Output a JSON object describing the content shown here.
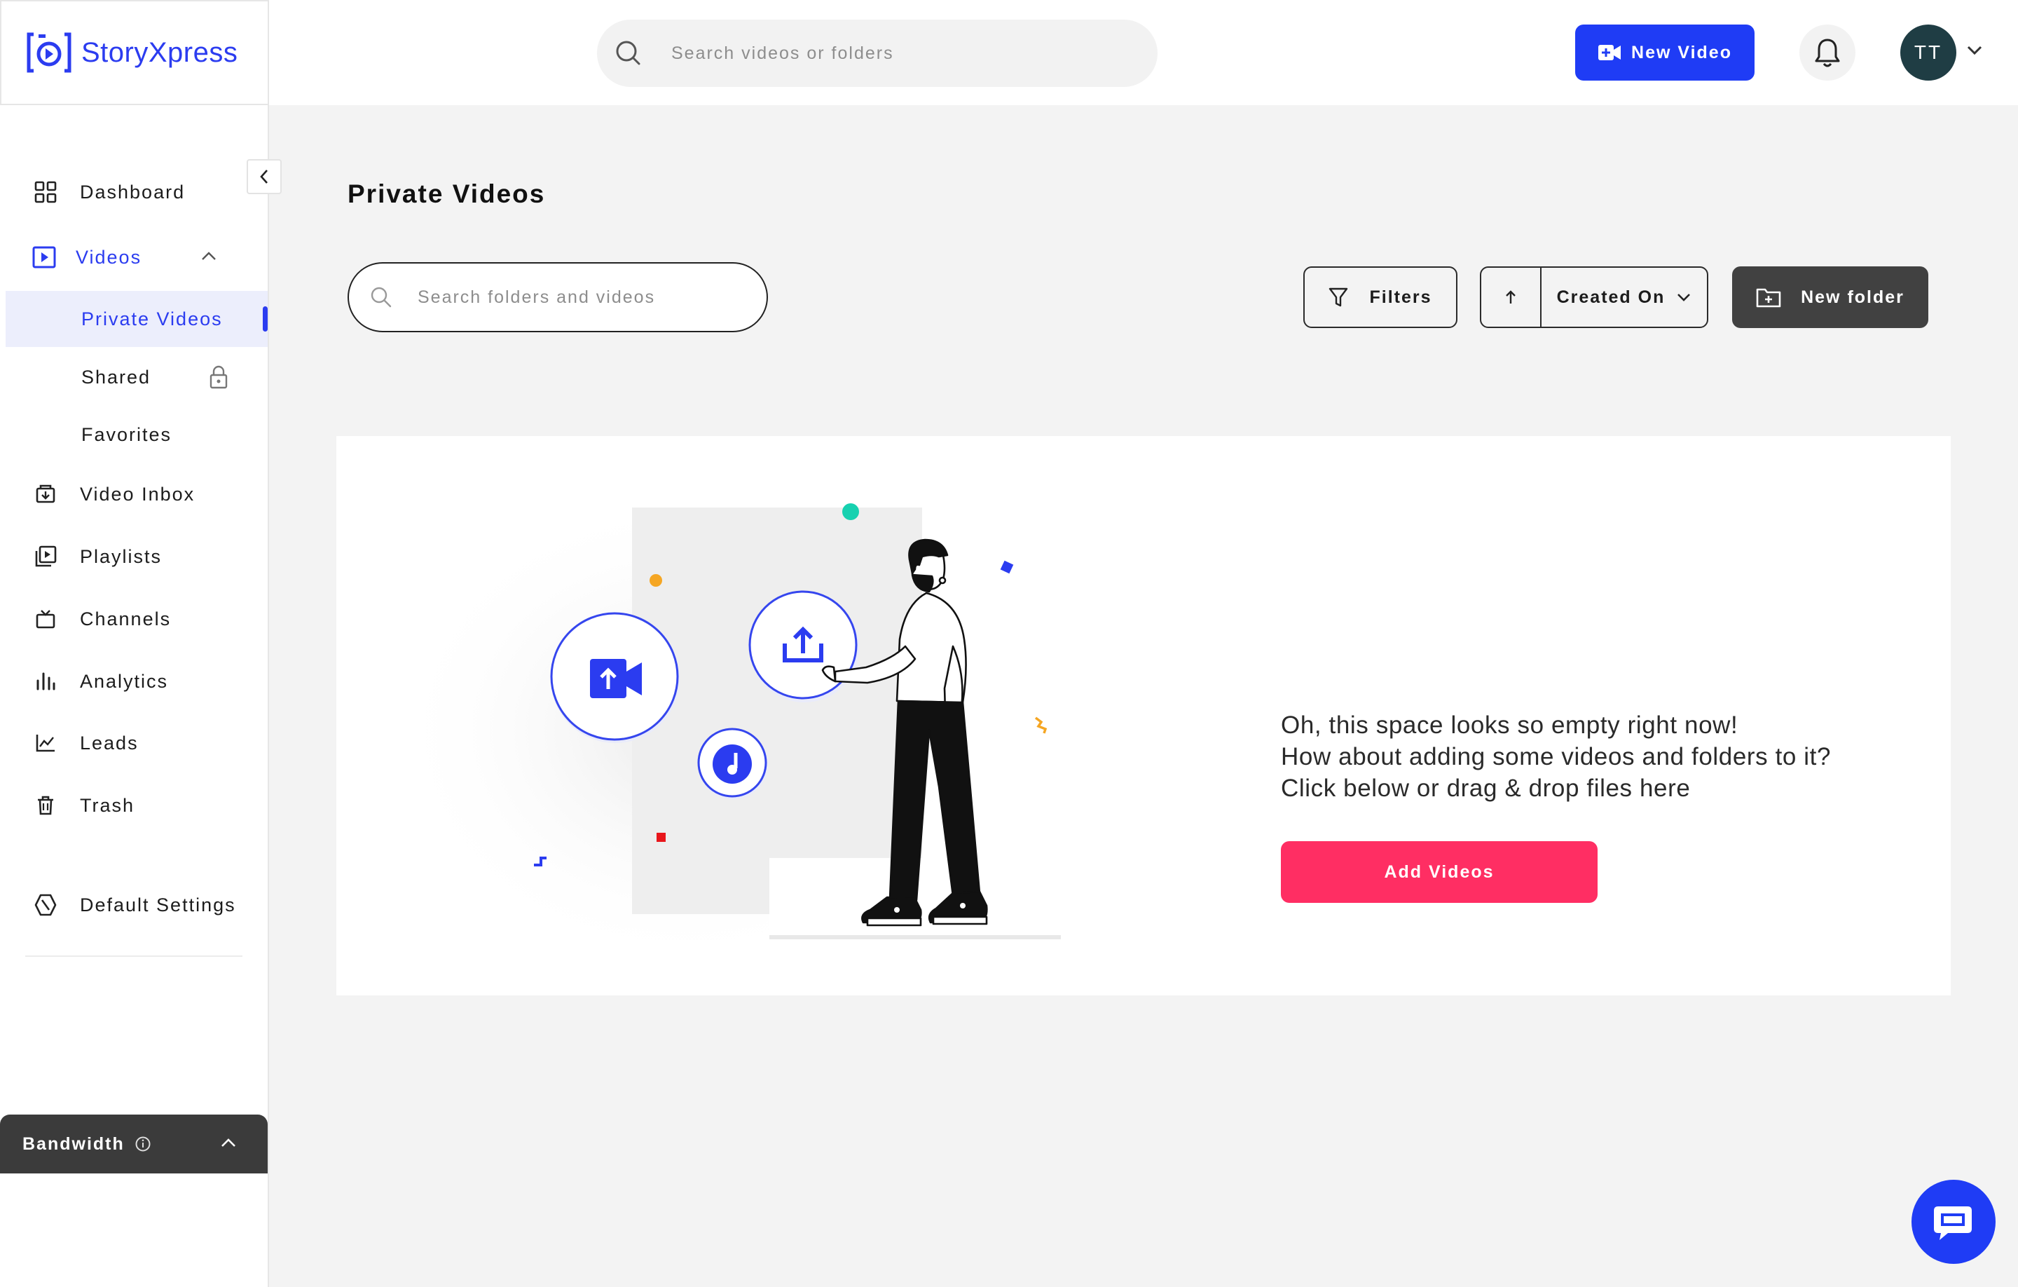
{
  "brand": {
    "name": "StoryXpress"
  },
  "header": {
    "search_placeholder": "Search videos or folders",
    "new_video_label": "New Video",
    "avatar_initials": "TT"
  },
  "sidebar": {
    "items": [
      {
        "label": "Dashboard",
        "icon": "grid-icon"
      },
      {
        "label": "Videos",
        "icon": "video-play-icon"
      },
      {
        "label": "Private Videos"
      },
      {
        "label": "Shared",
        "icon": "lock-icon"
      },
      {
        "label": "Favorites"
      },
      {
        "label": "Video Inbox",
        "icon": "inbox-icon"
      },
      {
        "label": "Playlists",
        "icon": "playlist-icon"
      },
      {
        "label": "Channels",
        "icon": "tv-icon"
      },
      {
        "label": "Analytics",
        "icon": "bar-chart-icon"
      },
      {
        "label": "Leads",
        "icon": "line-chart-icon"
      },
      {
        "label": "Trash",
        "icon": "trash-icon"
      },
      {
        "label": "Default Settings",
        "icon": "settings-icon"
      }
    ],
    "bandwidth_label": "Bandwidth"
  },
  "main": {
    "title": "Private Videos",
    "search_placeholder": "Search folders and videos",
    "filters_label": "Filters",
    "sort_label": "Created On",
    "new_folder_label": "New folder",
    "empty_state": {
      "lines": [
        "Oh, this space looks so empty right now!",
        "How about adding some videos and folders to it?",
        "Click below or drag & drop files here"
      ],
      "add_button": "Add Videos"
    }
  },
  "colors": {
    "brand_blue": "#2b3cf0",
    "primary_button": "#1f3cf5",
    "add_videos": "#ff2e63",
    "dark_button": "#414141",
    "avatar_bg": "#1f3d44"
  }
}
